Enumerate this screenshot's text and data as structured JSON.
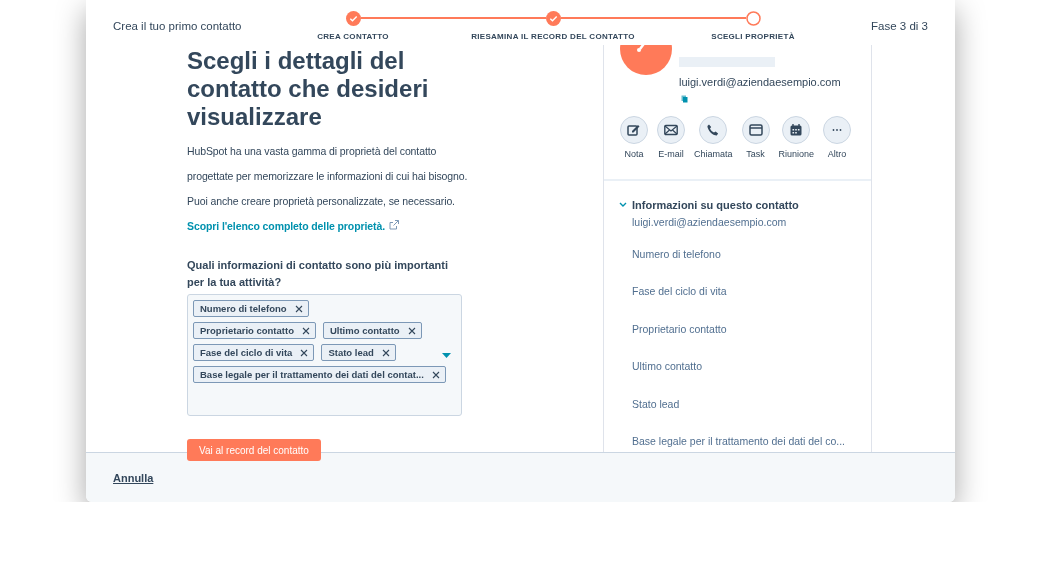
{
  "header": {
    "title": "Crea il tuo primo contatto",
    "steps": [
      {
        "label": "CREA CONTATTO",
        "completed": true
      },
      {
        "label": "RIESAMINA IL RECORD DEL CONTATTO",
        "completed": true
      },
      {
        "label": "SCEGLI PROPRIETÀ",
        "completed": false
      }
    ],
    "step_counter": "Fase 3 di 3"
  },
  "intro": {
    "heading": "Scegli i dettagli del contatto che desideri visualizzare",
    "text": "HubSpot ha una vasta gamma di proprietà del contatto progettate per memorizzare le informazioni di cui hai bisogno. Puoi anche creare proprietà personalizzate, se necessario.",
    "link": "Scopri l'elenco completo delle proprietà."
  },
  "question": "Quali informazioni di contatto sono più importanti per la tua attività?",
  "selected_properties": [
    "Numero di telefono",
    "Proprietario contatto",
    "Ultimo contatto",
    "Fase del ciclo di vita",
    "Stato lead",
    "Base legale per il trattamento dei dati del contat..."
  ],
  "primary_button": "Vai al record del contatto",
  "preview": {
    "email": "luigi.verdi@aziendaesempio.com",
    "actions": [
      {
        "kind": "note",
        "label": "Nota"
      },
      {
        "kind": "email",
        "label": "E-mail"
      },
      {
        "kind": "call",
        "label": "Chiamata"
      },
      {
        "kind": "task",
        "label": "Task"
      },
      {
        "kind": "meeting",
        "label": "Riunione"
      },
      {
        "kind": "more",
        "label": "Altro"
      }
    ],
    "section": {
      "title": "Informazioni su questo contatto",
      "expanded": true,
      "items": [
        "luigi.verdi@aziendaesempio.com",
        "Numero di telefono",
        "Fase del ciclo di vita",
        "Proprietario contatto",
        "Ultimo contatto",
        "Stato lead",
        "Base legale per il trattamento dei dati del co..."
      ]
    }
  },
  "footer": {
    "cancel": "Annulla"
  }
}
